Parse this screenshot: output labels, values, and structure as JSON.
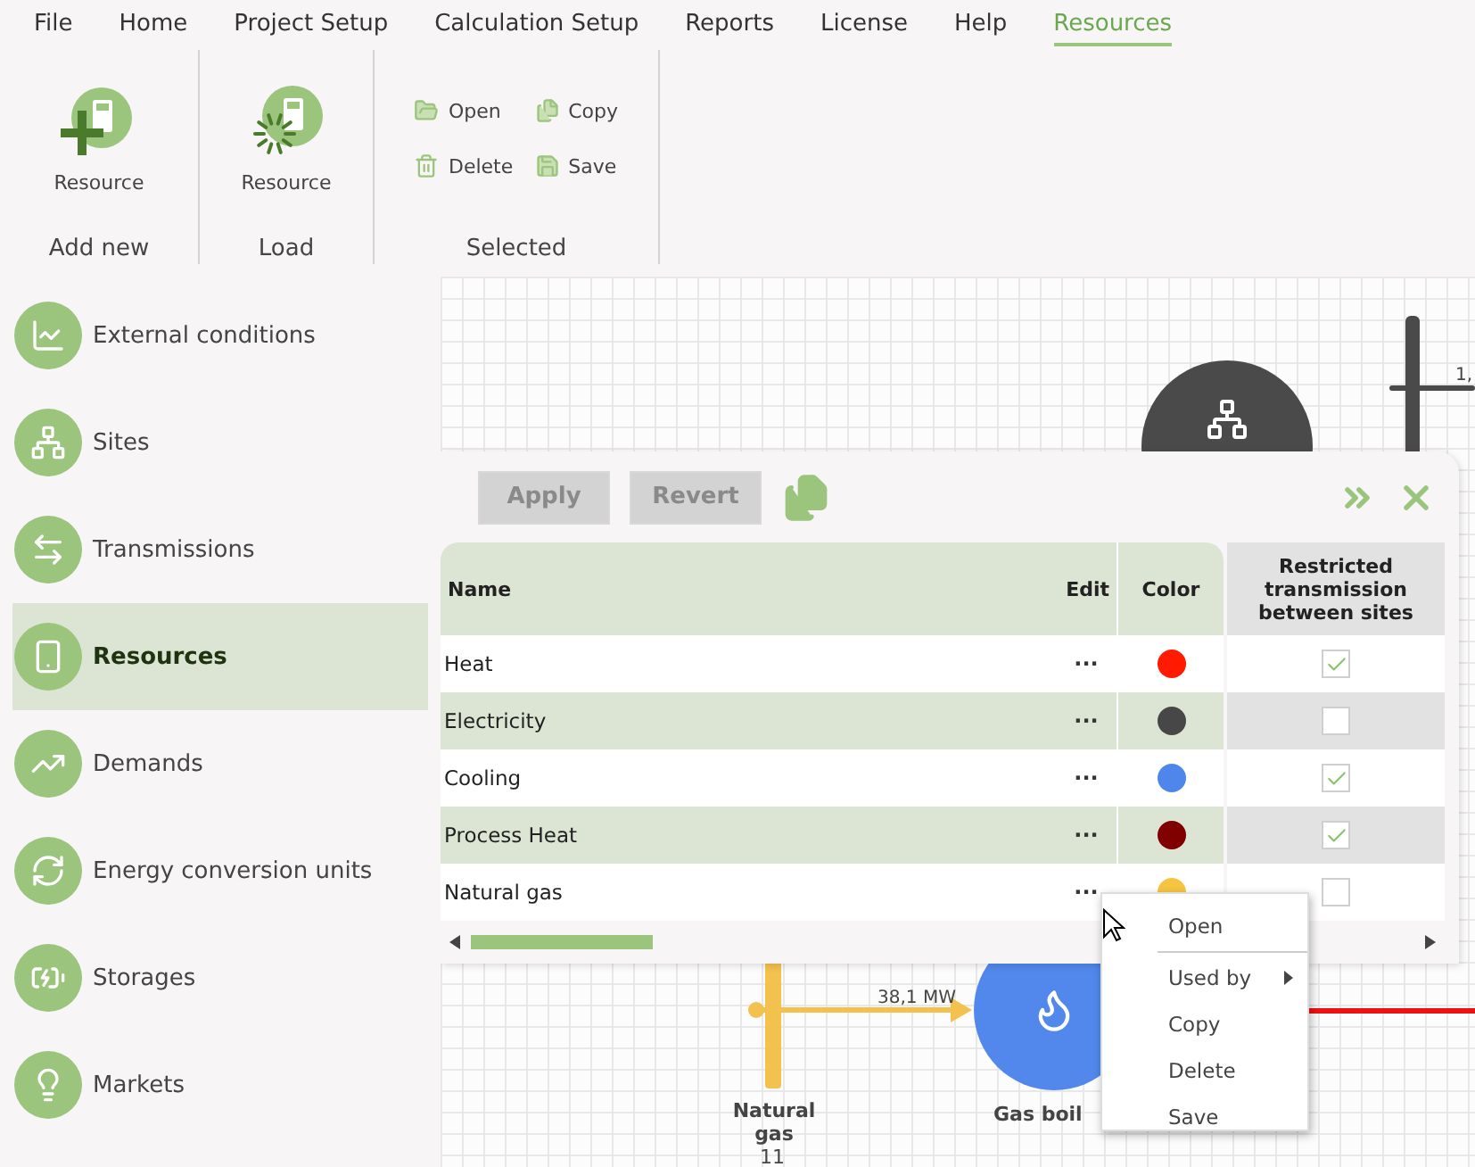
{
  "menu": [
    {
      "label": "File",
      "selected": false
    },
    {
      "label": "Home",
      "selected": false
    },
    {
      "label": "Project Setup",
      "selected": false
    },
    {
      "label": "Calculation Setup",
      "selected": false
    },
    {
      "label": "Reports",
      "selected": false
    },
    {
      "label": "License",
      "selected": false
    },
    {
      "label": "Help",
      "selected": false
    },
    {
      "label": "Resources",
      "selected": true
    }
  ],
  "ribbon": [
    {
      "caption": "Add new",
      "kind": "large",
      "buttons": [
        {
          "label": "Resource"
        }
      ]
    },
    {
      "caption": "Load",
      "kind": "large",
      "buttons": [
        {
          "label": "Resource"
        }
      ]
    },
    {
      "caption": "Selected",
      "kind": "small",
      "buttons": [
        {
          "label": "Open"
        },
        {
          "label": "Copy"
        },
        {
          "label": "Delete"
        },
        {
          "label": "Save"
        }
      ]
    }
  ],
  "sidebar": {
    "items": [
      {
        "label": "External conditions",
        "selected": false
      },
      {
        "label": "Sites",
        "selected": false
      },
      {
        "label": "Transmissions",
        "selected": false
      },
      {
        "label": "Resources",
        "selected": true
      },
      {
        "label": "Demands",
        "selected": false
      },
      {
        "label": "Energy conversion units",
        "selected": false
      },
      {
        "label": "Storages",
        "selected": false
      },
      {
        "label": "Markets",
        "selected": false
      }
    ]
  },
  "diagram": {
    "edge_label": "1,",
    "flow_label": "38,1 MW",
    "bus_label": "Natural gas",
    "bus_number": "11",
    "unit_label": "Gas boil"
  },
  "panel": {
    "buttons": [
      {
        "label": "Apply",
        "disabled": true
      },
      {
        "label": "Revert",
        "disabled": true
      }
    ],
    "table": {
      "columns": [
        "Name",
        "Edit",
        "Color",
        "Restricted transmission between sites"
      ],
      "rows": [
        {
          "name": "Heat",
          "edit": "···",
          "color": "#ff1a00",
          "restricted": true
        },
        {
          "name": "Electricity",
          "edit": "···",
          "color": "#474747",
          "restricted": false
        },
        {
          "name": "Cooling",
          "edit": "···",
          "color": "#4f86ec",
          "restricted": true
        },
        {
          "name": "Process Heat",
          "edit": "···",
          "color": "#800000",
          "restricted": true
        },
        {
          "name": "Natural gas",
          "edit": "···",
          "color": "#f5c542",
          "restricted": false
        }
      ]
    }
  },
  "context_menu": {
    "items": [
      {
        "kind": "item",
        "label": "Open"
      },
      {
        "kind": "separator"
      },
      {
        "kind": "submenu",
        "label": "Used by"
      },
      {
        "kind": "item",
        "label": "Copy"
      },
      {
        "kind": "item",
        "label": "Delete"
      },
      {
        "kind": "item",
        "label": "Save"
      }
    ]
  }
}
